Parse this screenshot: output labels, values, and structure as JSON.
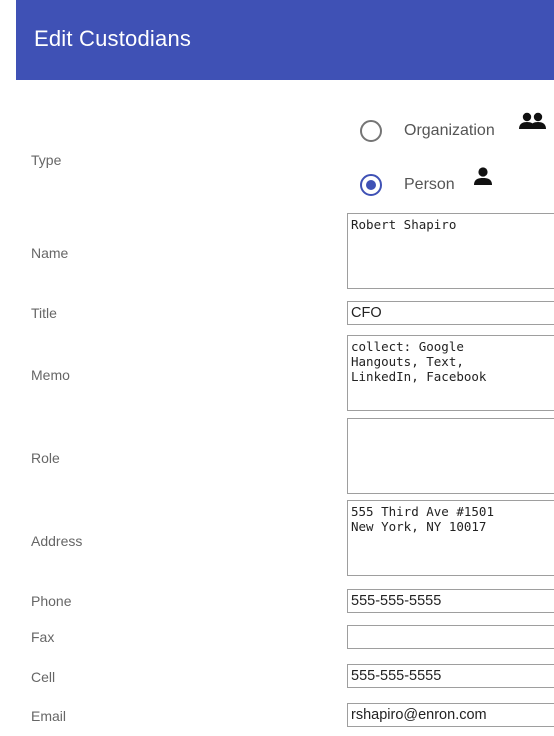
{
  "header": {
    "title": "Edit Custodians"
  },
  "form": {
    "type": {
      "label": "Type",
      "options": [
        {
          "label": "Organization",
          "icon": "group-icon",
          "checked": false
        },
        {
          "label": "Person",
          "icon": "person-icon",
          "checked": true
        }
      ]
    },
    "name": {
      "label": "Name",
      "value": "Robert Shapiro"
    },
    "title": {
      "label": "Title",
      "value": "CFO"
    },
    "memo": {
      "label": "Memo",
      "value": "collect: Google\nHangouts, Text,\nLinkedIn, Facebook"
    },
    "role": {
      "label": "Role",
      "value": ""
    },
    "address": {
      "label": "Address",
      "value": "555 Third Ave #1501\nNew York, NY 10017"
    },
    "phone": {
      "label": "Phone",
      "value": "555-555-5555"
    },
    "fax": {
      "label": "Fax",
      "value": ""
    },
    "cell": {
      "label": "Cell",
      "value": "555-555-5555"
    },
    "email": {
      "label": "Email",
      "value": "rshapiro@enron.com"
    }
  },
  "colors": {
    "accent": "#3f51b5",
    "label": "#666666",
    "border": "#9e9e9e"
  }
}
